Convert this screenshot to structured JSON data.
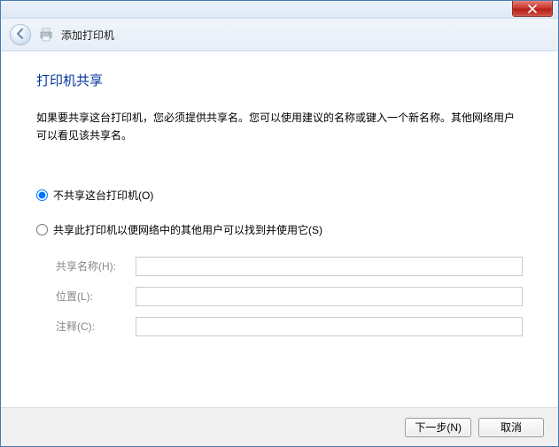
{
  "window": {
    "header_title": "添加打印机"
  },
  "page": {
    "title": "打印机共享",
    "description": "如果要共享这台打印机，您必须提供共享名。您可以使用建议的名称或键入一个新名称。其他网络用户可以看见该共享名。"
  },
  "options": {
    "no_share_label": "不共享这台打印机(O)",
    "share_label": "共享此打印机以便网络中的其他用户可以找到并使用它(S)"
  },
  "fields": {
    "share_name_label": "共享名称(H):",
    "location_label": "位置(L):",
    "comment_label": "注释(C):",
    "share_name_value": "",
    "location_value": "",
    "comment_value": ""
  },
  "footer": {
    "next_label": "下一步(N)",
    "cancel_label": "取消"
  }
}
